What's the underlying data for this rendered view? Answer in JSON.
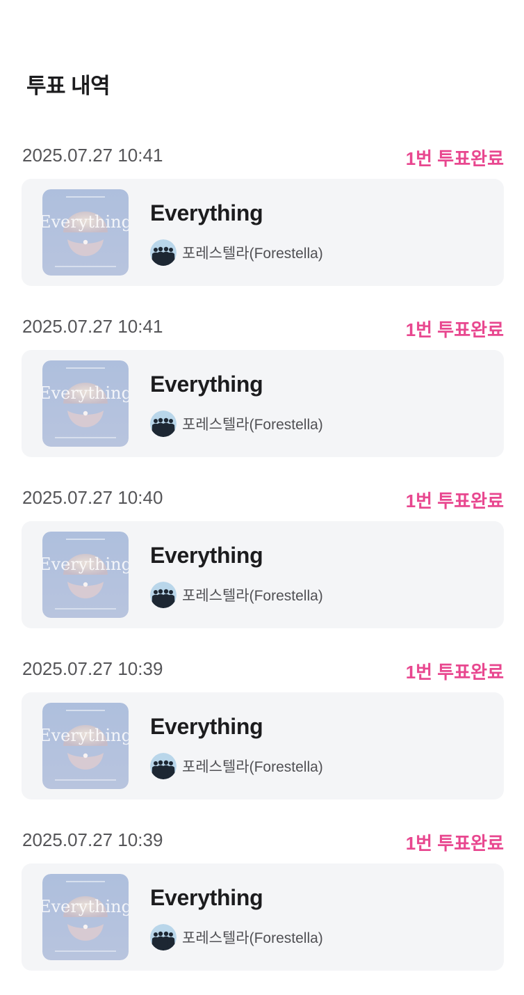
{
  "header": {
    "title": "투표 내역"
  },
  "entries": [
    {
      "timestamp": "2025.07.27 10:41",
      "status": "1번 투표완료",
      "song_title": "Everything",
      "artist": "포레스텔라(Forestella)"
    },
    {
      "timestamp": "2025.07.27 10:41",
      "status": "1번 투표완료",
      "song_title": "Everything",
      "artist": "포레스텔라(Forestella)"
    },
    {
      "timestamp": "2025.07.27 10:40",
      "status": "1번 투표완료",
      "song_title": "Everything",
      "artist": "포레스텔라(Forestella)"
    },
    {
      "timestamp": "2025.07.27 10:39",
      "status": "1번 투표완료",
      "song_title": "Everything",
      "artist": "포레스텔라(Forestella)"
    },
    {
      "timestamp": "2025.07.27 10:39",
      "status": "1번 투표완료",
      "song_title": "Everything",
      "artist": "포레스텔라(Forestella)"
    }
  ],
  "album_art": {
    "cover_text": "Everything",
    "icon": "album-cover-shell"
  },
  "colors": {
    "accent": "#e8478f",
    "card_background": "#f4f5f7",
    "title_text": "#1c1c1e",
    "meta_text": "#555558"
  }
}
